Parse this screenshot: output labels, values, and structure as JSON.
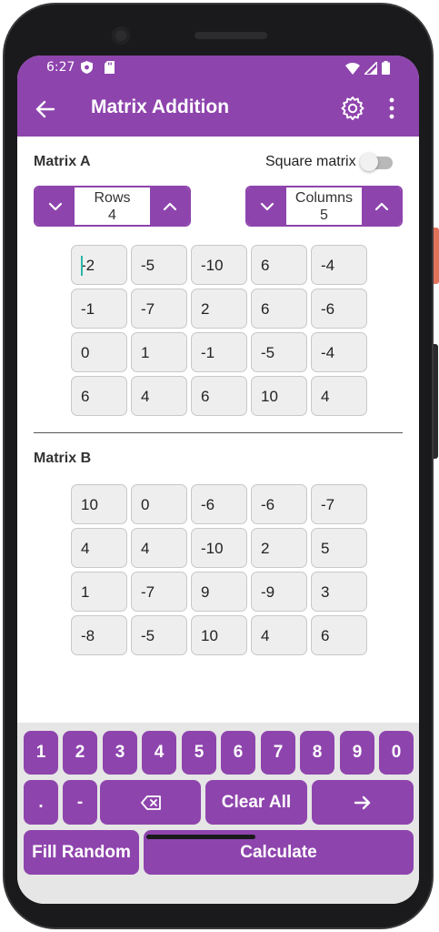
{
  "status": {
    "time": "6:27"
  },
  "appbar": {
    "title": "Matrix Addition"
  },
  "matrix_a": {
    "label": "Matrix A",
    "square_label": "Square matrix",
    "square_enabled": false,
    "rows_label": "Rows",
    "rows_value": "4",
    "cols_label": "Columns",
    "cols_value": "5",
    "cells": [
      [
        "-2",
        "-5",
        "-10",
        "6",
        "-4"
      ],
      [
        "-1",
        "-7",
        "2",
        "6",
        "-6"
      ],
      [
        "0",
        "1",
        "-1",
        "-5",
        "-4"
      ],
      [
        "6",
        "4",
        "6",
        "10",
        "4"
      ]
    ]
  },
  "matrix_b": {
    "label": "Matrix B",
    "cells": [
      [
        "10",
        "0",
        "-6",
        "-6",
        "-7"
      ],
      [
        "4",
        "4",
        "-10",
        "2",
        "5"
      ],
      [
        "1",
        "-7",
        "9",
        "-9",
        "3"
      ],
      [
        "-8",
        "-5",
        "10",
        "4",
        "6"
      ]
    ]
  },
  "keypad": {
    "digits": [
      "1",
      "2",
      "3",
      "4",
      "5",
      "6",
      "7",
      "8",
      "9",
      "0"
    ],
    "dot": ".",
    "minus": "-",
    "clear_all": "Clear All",
    "fill_random": "Fill Random",
    "calculate": "Calculate"
  },
  "colors": {
    "accent": "#8e44ad",
    "cell_bg": "#eeeeee",
    "keypad_bg": "#e6e6e6"
  }
}
